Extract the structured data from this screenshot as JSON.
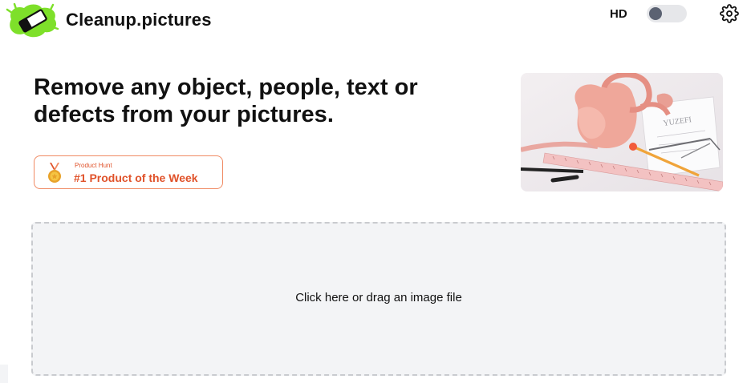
{
  "header": {
    "brand": "Cleanup.pictures",
    "logo_icon": "eraser-logo-icon",
    "hd_label": "HD",
    "hd_enabled": false,
    "settings_icon": "gear-icon"
  },
  "hero": {
    "headline_line1": "Remove any object, people, text or",
    "headline_line2": "defects from your pictures.",
    "badge": {
      "small": "Product Hunt",
      "big": "#1 Product of the Week",
      "icon": "medal-icon"
    },
    "image_alt": "Pink handbag on drafting table with rulers and pencils"
  },
  "dropzone": {
    "label": "Click here or drag an image file"
  },
  "colors": {
    "accent": "#e0522a",
    "logo_green": "#7ee02a",
    "dropzone_bg": "#f3f4f6"
  }
}
